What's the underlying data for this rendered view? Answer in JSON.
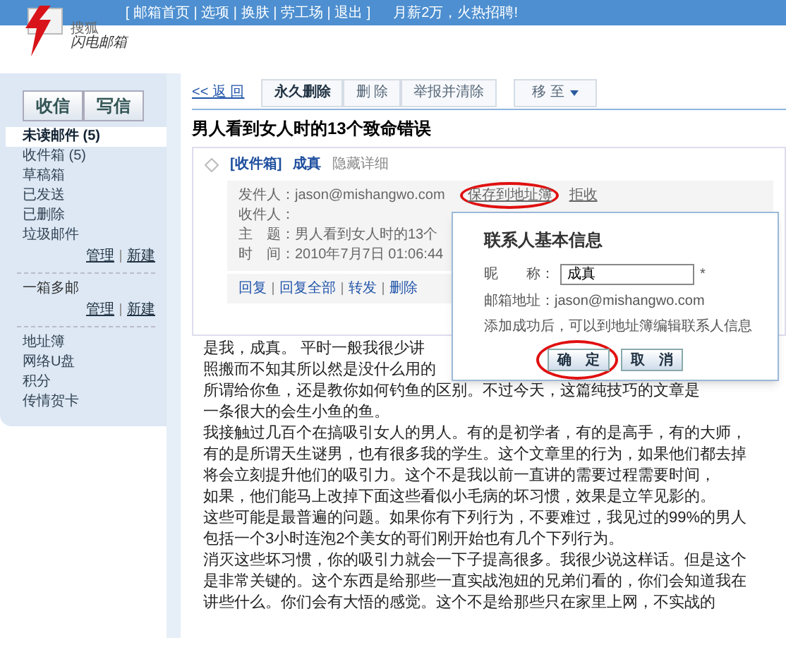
{
  "top_bar": {
    "links": "[ 邮箱首页 | 选项 | 换肤 | 劳工场 | 退出 ]",
    "promo": "月薪2万，火热招聘!"
  },
  "logo": {
    "small": "搜狐",
    "name": "闪电邮箱"
  },
  "sidebar": {
    "buttons": [
      "收信",
      "写信"
    ],
    "folders": [
      {
        "label": "未读邮件 (5)",
        "selected": true
      },
      {
        "label": "收件箱 (5)",
        "selected": false
      },
      {
        "label": "草稿箱",
        "selected": false
      },
      {
        "label": "已发送",
        "selected": false
      },
      {
        "label": "已删除",
        "selected": false
      },
      {
        "label": "垃圾邮件",
        "selected": false
      }
    ],
    "folder_links": [
      "管理",
      "新建"
    ],
    "multi": "一箱多邮",
    "multi_links": [
      "管理",
      "新建"
    ],
    "tools": [
      "地址簿",
      "网络U盘",
      "积分",
      "传情贺卡"
    ]
  },
  "toolbar": {
    "back": "<< 返 回",
    "buttons": [
      "永久删除",
      "删 除",
      "举报并清除"
    ],
    "move": "移 至"
  },
  "mail": {
    "title": "男人看到女人时的13个致命错误",
    "folder": "[收件箱]",
    "sender_name": "成真",
    "hide": "隐藏详细",
    "fields": [
      {
        "label": "发件人：",
        "value": "jason@mishangwo.com"
      },
      {
        "label": "收件人："
      },
      {
        "label": "主　题：",
        "value": "男人看到女人时的13个"
      },
      {
        "label": "时　间：",
        "value": "2010年7月7日 01:06:44"
      }
    ],
    "save_link": "保存到地址簿",
    "reject_link": "拒收",
    "actions": [
      "回复",
      "回复全部",
      "转发",
      "删除"
    ],
    "body": [
      "是我，成真。 平时一般我很少讲",
      "照搬而不知其所以然是没什么用的",
      "所谓给你鱼，还是教你如何钓鱼的区别。不过今天，这篇纯技巧的文章是",
      "一条很大的会生小鱼的鱼。",
      "我接触过几百个在搞吸引女人的男人。有的是初学者，有的是高手，有的大师，",
      "有的是所谓天生谜男，也有很多我的学生。这个文章里的行为，如果他们都去掉",
      "将会立刻提升他们的吸引力。这个不是我以前一直讲的需要过程需要时间，",
      "如果，他们能马上改掉下面这些看似小毛病的坏习惯，效果是立竿见影的。",
      "这些可能是最普遍的问题。如果你有下列行为，不要难过，我见过的99%的男人",
      "包括一个3小时连泡2个美女的哥们刚开始也有几个下列行为。",
      "消灭这些坏习惯，你的吸引力就会一下子提高很多。我很少说这样话。但是这个",
      "是非常关键的。这个东西是给那些一直实战泡妞的兄弟们看的，你们会知道我在",
      "讲些什么。你们会有大悟的感觉。这个不是给那些只在家里上网，不实战的"
    ]
  },
  "dialog": {
    "title": "联系人基本信息",
    "nickname_label": "昵　　称：",
    "nickname": "成真",
    "required": "*",
    "email": "邮箱地址：jason@mishangwo.com",
    "hint": "添加成功后，可以到地址簿编辑联系人信息",
    "ok": "确　定",
    "cancel": "取　消"
  }
}
